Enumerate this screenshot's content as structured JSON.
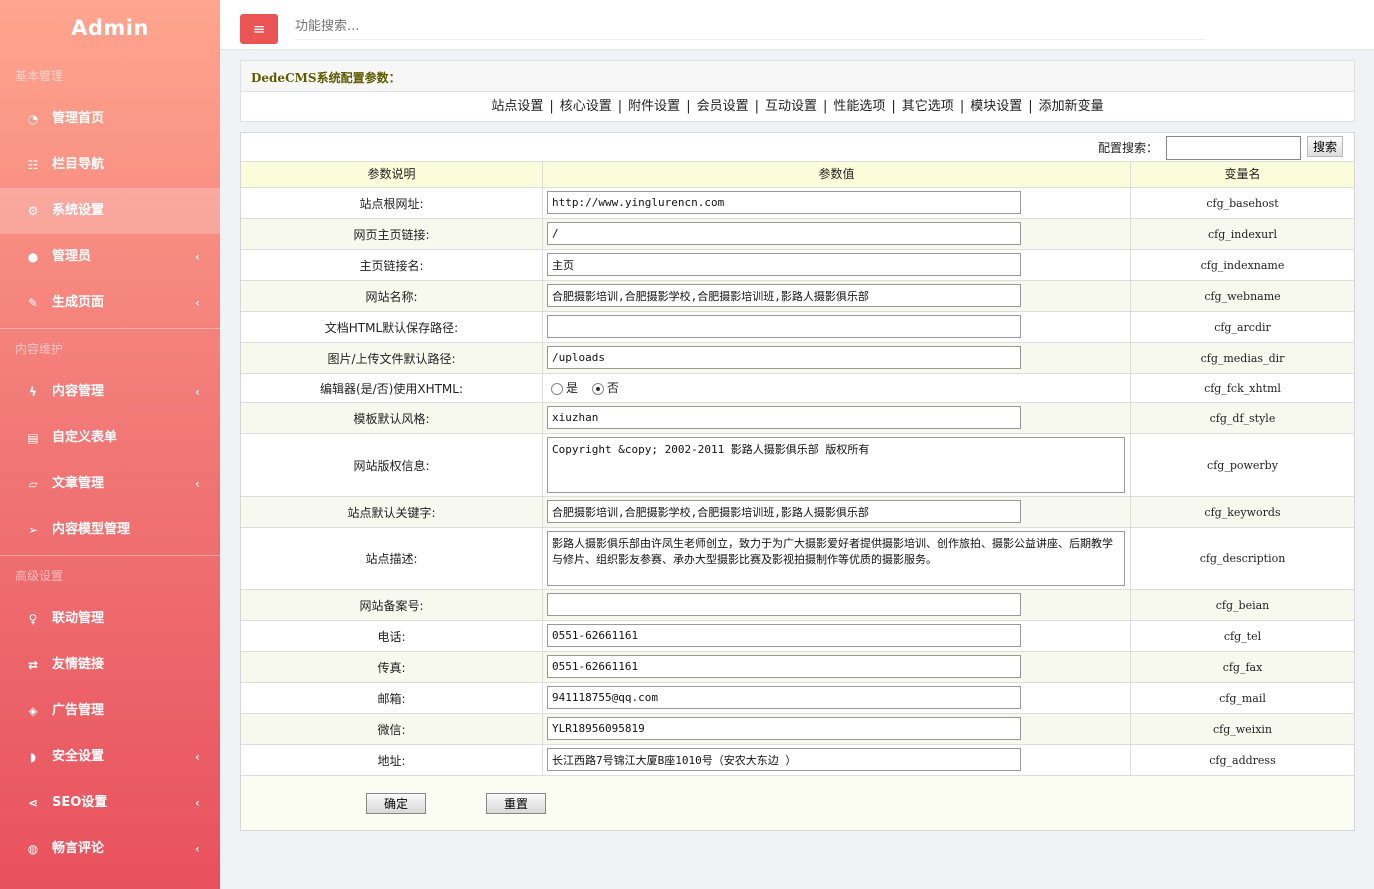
{
  "sidebar": {
    "brand": "Admin",
    "sections": [
      {
        "title": "基本管理"
      },
      {
        "title": "内容维护"
      },
      {
        "title": "高级设置"
      }
    ],
    "items": [
      {
        "label": "管理首页",
        "icon": "dashboard-icon"
      },
      {
        "label": "栏目导航",
        "icon": "list-icon"
      },
      {
        "label": "系统设置",
        "icon": "gear-icon"
      },
      {
        "label": "管理员",
        "icon": "user-icon"
      },
      {
        "label": "生成页面",
        "icon": "brush-icon"
      },
      {
        "label": "内容管理",
        "icon": "bolt-icon"
      },
      {
        "label": "自定义表单",
        "icon": "form-icon"
      },
      {
        "label": "文章管理",
        "icon": "folder-open-icon"
      },
      {
        "label": "内容模型管理",
        "icon": "send-icon"
      },
      {
        "label": "联动管理",
        "icon": "lightbulb-icon"
      },
      {
        "label": "友情链接",
        "icon": "exchange-icon"
      },
      {
        "label": "广告管理",
        "icon": "cube-icon"
      },
      {
        "label": "安全设置",
        "icon": "shield-icon"
      },
      {
        "label": "SEO设置",
        "icon": "share-icon"
      },
      {
        "label": "畅言评论",
        "icon": "comments-icon"
      }
    ]
  },
  "topbar": {
    "search_placeholder": "功能搜索..."
  },
  "panel": {
    "title": "DedeCMS系统配置参数："
  },
  "tabs": [
    "站点设置",
    "核心设置",
    "附件设置",
    "会员设置",
    "互动设置",
    "性能选项",
    "其它选项",
    "模块设置",
    "添加新变量"
  ],
  "config_search": {
    "label": "配置搜索：",
    "button": "搜索",
    "value": ""
  },
  "table": {
    "headers": [
      "参数说明",
      "参数值",
      "变量名"
    ],
    "rows": [
      {
        "label": "站点根网址:",
        "value": "http://www.yinglurencn.com",
        "var": "cfg_basehost"
      },
      {
        "label": "网页主页链接:",
        "value": "/",
        "var": "cfg_indexurl"
      },
      {
        "label": "主页链接名:",
        "value": "主页",
        "var": "cfg_indexname"
      },
      {
        "label": "网站名称:",
        "value": "合肥摄影培训,合肥摄影学校,合肥摄影培训班,影路人摄影俱乐部",
        "var": "cfg_webname"
      },
      {
        "label": "文档HTML默认保存路径:",
        "value": "",
        "var": "cfg_arcdir"
      },
      {
        "label": "图片/上传文件默认路径:",
        "value": "/uploads",
        "var": "cfg_medias_dir"
      },
      {
        "label": "编辑器(是/否)使用XHTML:",
        "radio_yes": "是",
        "radio_no": "否",
        "selected": "否",
        "var": "cfg_fck_xhtml"
      },
      {
        "label": "模板默认风格:",
        "value": "xiuzhan",
        "var": "cfg_df_style"
      },
      {
        "label": "网站版权信息:",
        "value": "Copyright &copy; 2002-2011 影路人摄影俱乐部 版权所有",
        "var": "cfg_powerby"
      },
      {
        "label": "站点默认关键字:",
        "value": "合肥摄影培训,合肥摄影学校,合肥摄影培训班,影路人摄影俱乐部",
        "var": "cfg_keywords"
      },
      {
        "label": "站点描述:",
        "value": "影路人摄影俱乐部由许凤生老师创立，致力于为广大摄影爱好者提供摄影培训、创作旅拍、摄影公益讲座、后期教学与修片、组织影友参赛、承办大型摄影比赛及影视拍摄制作等优质的摄影服务。",
        "var": "cfg_description"
      },
      {
        "label": "网站备案号:",
        "value": "",
        "var": "cfg_beian"
      },
      {
        "label": "电话:",
        "value": "0551-62661161",
        "var": "cfg_tel"
      },
      {
        "label": "传真:",
        "value": "0551-62661161",
        "var": "cfg_fax"
      },
      {
        "label": "邮箱:",
        "value": "941118755@qq.com",
        "var": "cfg_mail"
      },
      {
        "label": "微信:",
        "value": "YLR18956095819",
        "var": "cfg_weixin"
      },
      {
        "label": "地址:",
        "value": "长江西路7号锦江大厦B座1010号（安农大东边 ）",
        "var": "cfg_address"
      }
    ]
  },
  "actions": {
    "confirm": "确定",
    "reset": "重置"
  }
}
